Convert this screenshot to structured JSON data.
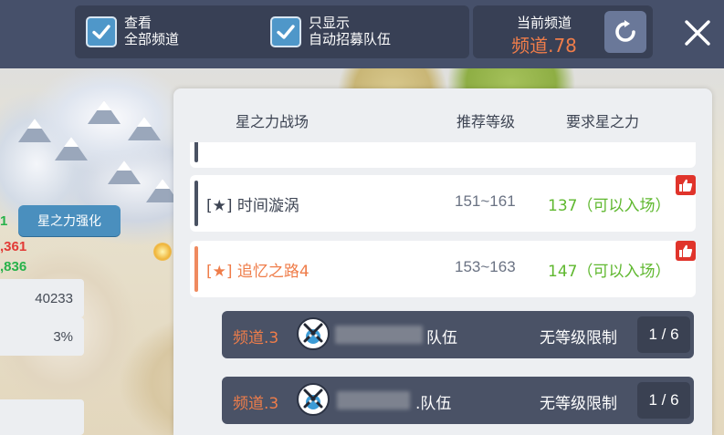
{
  "topbar": {
    "filter_all": {
      "label_line1": "查看",
      "label_line2": "全部频道",
      "checked": true
    },
    "filter_auto": {
      "label_line1": "只显示",
      "label_line2": "自动招募队伍",
      "checked": true
    },
    "current_channel": {
      "caption": "当前频道",
      "value": "频道.78"
    },
    "refresh_icon": "refresh-icon",
    "close_icon": "close-icon"
  },
  "left_panel": {
    "enhance_button": "星之力强化",
    "stat_green_top": "1",
    "stat_red": ",361",
    "stat_green": ",836",
    "stat_box_1": "40233",
    "stat_box_2": "3%"
  },
  "table": {
    "headers": {
      "name": "星之力战场",
      "level": "推荐等级",
      "star": "要求星之力"
    },
    "rows": [
      {
        "name": "",
        "level": "",
        "req": "",
        "recommended": false
      },
      {
        "name": "[★] 时间漩涡",
        "level": "151~161",
        "req": "137（可以入场）",
        "recommended": true
      },
      {
        "name": "[★] 追忆之路4",
        "level": "153~163",
        "req": "147（可以入场）",
        "recommended": true
      }
    ],
    "teams": [
      {
        "channel": "频道.3",
        "name": "队伍",
        "limit": "无等级限制",
        "count": "1 / 6"
      },
      {
        "channel": "频道.3",
        "name": ".队伍",
        "limit": "无等级限制",
        "count": "1 / 6"
      }
    ]
  },
  "colors": {
    "accent_orange": "#ef7d4a",
    "ok_green": "#5fb82f",
    "topbar_bg": "#46506a",
    "check_blue": "#4f97c9",
    "thumb_red": "#e0342b"
  }
}
